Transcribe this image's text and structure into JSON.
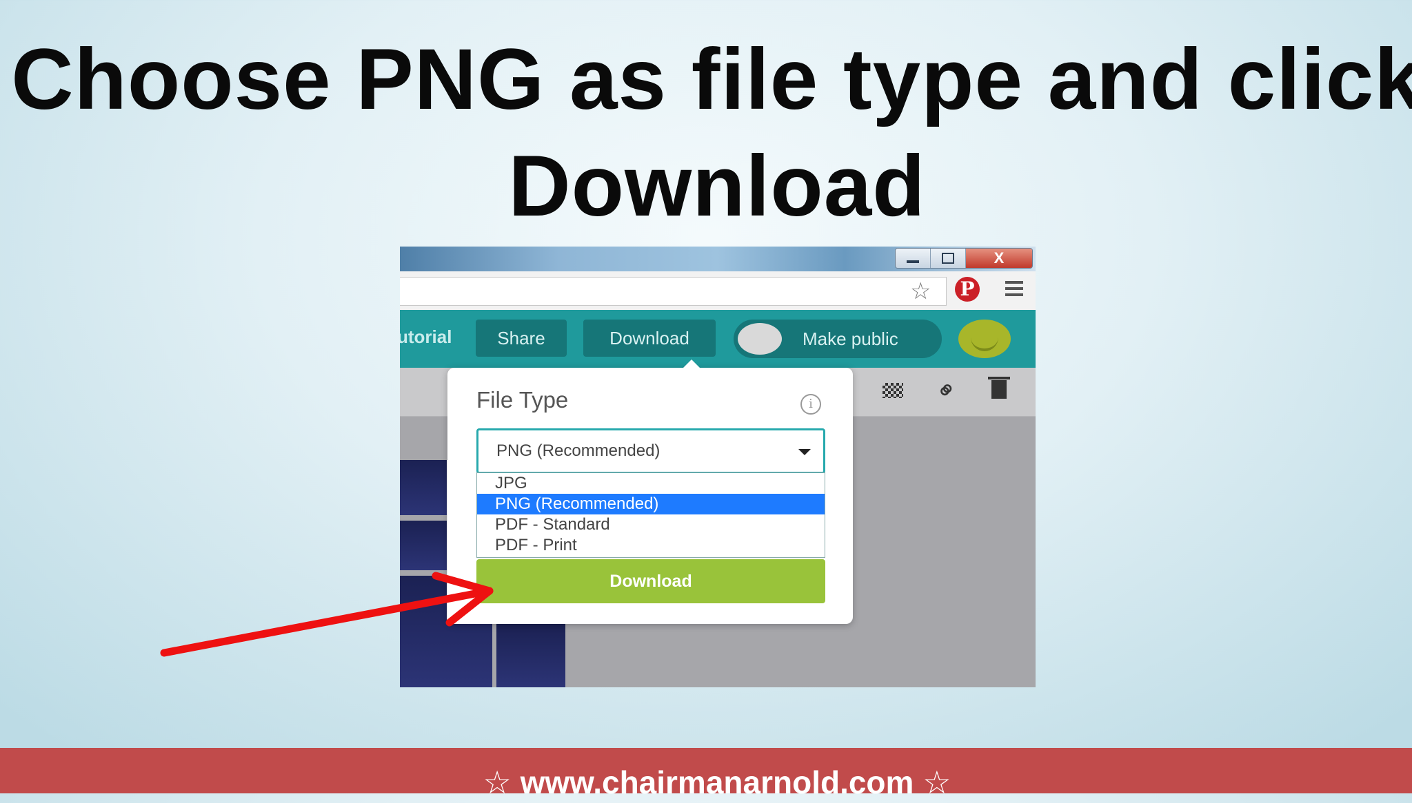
{
  "slide": {
    "title": "Choose PNG as file type and click Download",
    "footer": "☆ www.chairmanarnold.com ☆"
  },
  "browser": {
    "window_buttons": {
      "close": "X"
    },
    "star_icon": "☆",
    "pinterest_icon": "P"
  },
  "app_toolbar": {
    "tutorial_label": "utorial",
    "share_label": "Share",
    "download_label": "Download",
    "make_public_label": "Make public"
  },
  "download_dialog": {
    "title": "File Type",
    "info_icon": "i",
    "selected_value": "PNG (Recommended)",
    "options": [
      "JPG",
      "PNG (Recommended)",
      "PDF - Standard",
      "PDF - Print"
    ],
    "download_button": "Download"
  },
  "colors": {
    "toolbar": "#1f9a9c",
    "select_border": "#27a9ad",
    "download_button": "#99c33a",
    "highlight": "#1e7bff",
    "footer": "#c14b4b",
    "arrow": "#ee1111"
  },
  "icons": [
    "star-icon",
    "pinterest-icon",
    "menu-icon",
    "checker-icon",
    "link-icon",
    "trash-icon",
    "info-icon",
    "chevron-down-icon"
  ]
}
